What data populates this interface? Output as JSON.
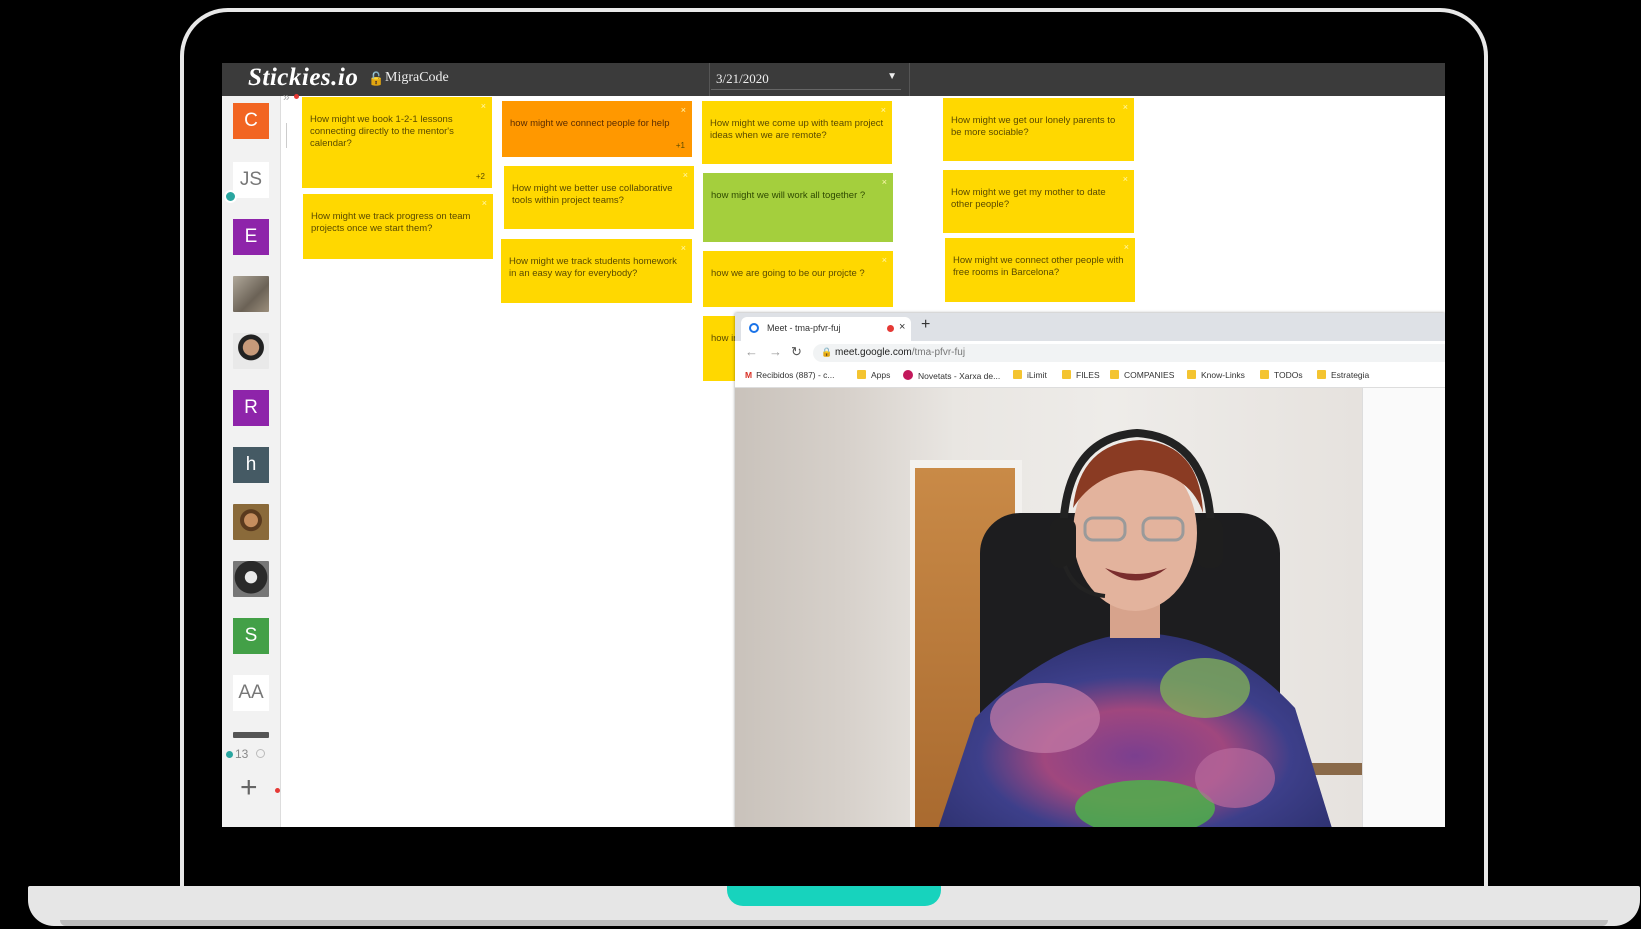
{
  "app": {
    "logo": "Stickies.io",
    "board_name": "MigraCode",
    "date": "3/21/2020"
  },
  "sidebar": {
    "avatars": [
      {
        "label": "C",
        "color": "#f26522"
      },
      {
        "label": "JS",
        "color": "#ffffff"
      },
      {
        "label": "E",
        "color": "#8e24aa"
      },
      {
        "label": "",
        "color": "#888888"
      },
      {
        "label": "",
        "color": "#777777"
      },
      {
        "label": "R",
        "color": "#8e24aa"
      },
      {
        "label": "h",
        "color": "#455a64"
      },
      {
        "label": "",
        "color": "#6d5a3c"
      },
      {
        "label": "",
        "color": "#444444"
      },
      {
        "label": "S",
        "color": "#43a047"
      },
      {
        "label": "AA",
        "color": "#ffffff"
      }
    ],
    "online_count": "13",
    "toggle": "»"
  },
  "notes": [
    {
      "text": "How might we book 1-2-1 lessons connecting directly to the mentor's calendar?",
      "color": "yellow",
      "votes": "+2"
    },
    {
      "text": "How might we track progress on team projects once we start them?",
      "color": "yellow",
      "votes": ""
    },
    {
      "text": "how might we connect people for help",
      "color": "orange",
      "votes": "+1"
    },
    {
      "text": "How might we better use collaborative tools within project teams?",
      "color": "yellow",
      "votes": ""
    },
    {
      "text": "How might we track students homework in an easy way for everybody?",
      "color": "yellow",
      "votes": ""
    },
    {
      "text": "How might we come up with team project ideas when we are remote?",
      "color": "yellow",
      "votes": ""
    },
    {
      "text": "how might we will work all together ?",
      "color": "green",
      "votes": ""
    },
    {
      "text": "how we are going to be our projcte ?",
      "color": "yellow",
      "votes": ""
    },
    {
      "text": "how instr",
      "color": "yellow",
      "votes": ""
    },
    {
      "text": "How might we get our lonely parents to be more sociable?",
      "color": "yellow",
      "votes": ""
    },
    {
      "text": "How might we get my mother to date other people?",
      "color": "yellow",
      "votes": ""
    },
    {
      "text": "How might we connect other people with free rooms in Barcelona?",
      "color": "yellow",
      "votes": ""
    }
  ],
  "meet": {
    "tab_title": "Meet - tma-pfvr-fuj",
    "url_host": "meet.google.com",
    "url_path": "/tma-pfvr-fuj",
    "bookmarks": [
      "Recibidos (887) - c...",
      "Apps",
      "Novetats - Xarxa de...",
      "iLimit",
      "FILES",
      "COMPANIES",
      "Know-Links",
      "TODOs",
      "Estrategia"
    ]
  },
  "colors": {
    "note_yellow": "#ffd800",
    "note_orange": "#ff9800",
    "note_green": "#a4cf3d",
    "accent_teal": "#17d3bd"
  }
}
